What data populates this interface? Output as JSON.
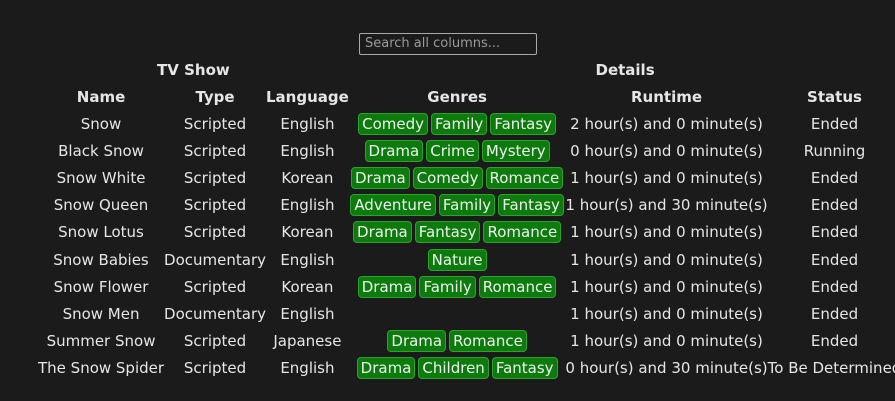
{
  "search": {
    "placeholder": "Search all columns..."
  },
  "table": {
    "group_headers": {
      "tv_show": "TV Show",
      "details": "Details"
    },
    "columns": [
      "Name",
      "Type",
      "Language",
      "Genres",
      "Runtime",
      "Status"
    ],
    "rows": [
      {
        "name": "Snow",
        "type": "Scripted",
        "language": "English",
        "genres": [
          "Comedy",
          "Family",
          "Fantasy"
        ],
        "runtime": "2 hour(s) and 0 minute(s)",
        "status": "Ended"
      },
      {
        "name": "Black Snow",
        "type": "Scripted",
        "language": "English",
        "genres": [
          "Drama",
          "Crime",
          "Mystery"
        ],
        "runtime": "0 hour(s) and 0 minute(s)",
        "status": "Running"
      },
      {
        "name": "Snow White",
        "type": "Scripted",
        "language": "Korean",
        "genres": [
          "Drama",
          "Comedy",
          "Romance"
        ],
        "runtime": "1 hour(s) and 0 minute(s)",
        "status": "Ended"
      },
      {
        "name": "Snow Queen",
        "type": "Scripted",
        "language": "English",
        "genres": [
          "Adventure",
          "Family",
          "Fantasy"
        ],
        "runtime": "1 hour(s) and 30 minute(s)",
        "status": "Ended"
      },
      {
        "name": "Snow Lotus",
        "type": "Scripted",
        "language": "Korean",
        "genres": [
          "Drama",
          "Fantasy",
          "Romance"
        ],
        "runtime": "1 hour(s) and 0 minute(s)",
        "status": "Ended"
      },
      {
        "name": "Snow Babies",
        "type": "Documentary",
        "language": "English",
        "genres": [
          "Nature"
        ],
        "runtime": "1 hour(s) and 0 minute(s)",
        "status": "Ended"
      },
      {
        "name": "Snow Flower",
        "type": "Scripted",
        "language": "Korean",
        "genres": [
          "Drama",
          "Family",
          "Romance"
        ],
        "runtime": "1 hour(s) and 0 minute(s)",
        "status": "Ended"
      },
      {
        "name": "Snow Men",
        "type": "Documentary",
        "language": "English",
        "genres": [],
        "runtime": "1 hour(s) and 0 minute(s)",
        "status": "Ended"
      },
      {
        "name": "Summer Snow",
        "type": "Scripted",
        "language": "Japanese",
        "genres": [
          "Drama",
          "Romance"
        ],
        "runtime": "1 hour(s) and 0 minute(s)",
        "status": "Ended"
      },
      {
        "name": "The Snow Spider",
        "type": "Scripted",
        "language": "English",
        "genres": [
          "Drama",
          "Children",
          "Fantasy"
        ],
        "runtime": "0 hour(s) and 30 minute(s)",
        "status": "To Be Determined"
      }
    ]
  },
  "colors": {
    "background": "#1b1b1b",
    "chip_bg": "#0b7b0b",
    "chip_border": "#30a030",
    "text": "#e6e6e6"
  }
}
